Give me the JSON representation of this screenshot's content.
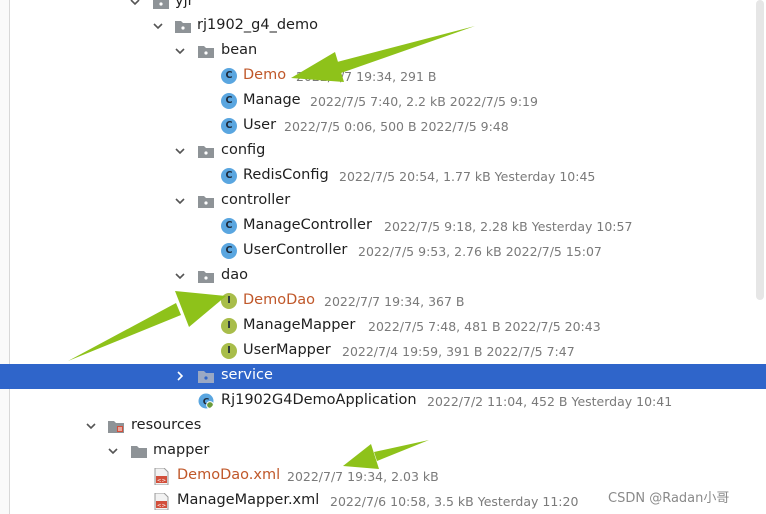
{
  "tree": {
    "yjr": "yjr",
    "demo_pkg": "rj1902_g4_demo",
    "bean": "bean",
    "demo": {
      "name": "Demo",
      "meta": "2022/7/7 19:34, 291 B"
    },
    "manage": {
      "name": "Manage",
      "meta": "2022/7/5 7:40, 2.2 kB 2022/7/5 9:19"
    },
    "user": {
      "name": "User",
      "meta": "2022/7/5 0:06, 500 B 2022/7/5 9:48"
    },
    "config": "config",
    "redisconfig": {
      "name": "RedisConfig",
      "meta": "2022/7/5 20:54, 1.77 kB Yesterday 10:45"
    },
    "controller": "controller",
    "managecontroller": {
      "name": "ManageController",
      "meta": "2022/7/5 9:18, 2.28 kB Yesterday 10:57"
    },
    "usercontroller": {
      "name": "UserController",
      "meta": "2022/7/5 9:53, 2.76 kB 2022/7/5 15:07"
    },
    "dao": "dao",
    "demodao": {
      "name": "DemoDao",
      "meta": "2022/7/7 19:34, 367 B"
    },
    "managemapper": {
      "name": "ManageMapper",
      "meta": "2022/7/5 7:48, 481 B 2022/7/5 20:43"
    },
    "usermapper": {
      "name": "UserMapper",
      "meta": "2022/7/4 19:59, 391 B 2022/7/5 7:47"
    },
    "service": "service",
    "app": {
      "name": "Rj1902G4DemoApplication",
      "meta": "2022/7/2 11:04, 452 B Yesterday 10:41"
    },
    "resources": "resources",
    "mapper": "mapper",
    "demodao_xml": {
      "name": "DemoDao.xml",
      "meta": "2022/7/7 19:34, 2.03 kB"
    },
    "managemapper_xml": {
      "name": "ManageMapper.xml",
      "meta": "2022/7/6 10:58, 3.5 kB Yesterday 11:20"
    }
  },
  "icons": {
    "class": "C",
    "interface": "I"
  },
  "colors": {
    "selection": "#2f65ca",
    "new_file": "#c0582a",
    "arrow": "#8ec21a"
  },
  "watermark": "CSDN @Radan小哥"
}
